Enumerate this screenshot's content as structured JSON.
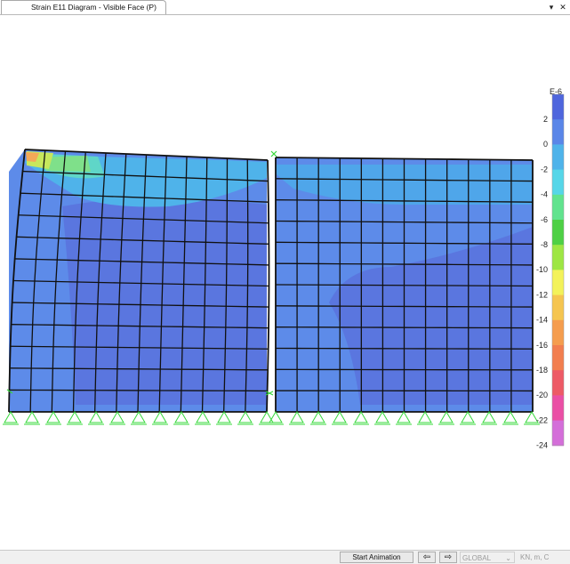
{
  "window": {
    "tab_title": "Strain E11 Diagram - Visible Face  (P)",
    "dropdown_icon": "chevron-down-icon",
    "close_icon": "close-icon"
  },
  "legend": {
    "title": "E-6",
    "ticks": [
      "2",
      "0",
      "-2",
      "-4",
      "-6",
      "-8",
      "-10",
      "-12",
      "-14",
      "-16",
      "-18",
      "-20",
      "-22",
      "-24"
    ],
    "colors": [
      "#4f66dd",
      "#5a86e8",
      "#4fb3ea",
      "#56d6e8",
      "#61e38e",
      "#4ed045",
      "#9ee644",
      "#f3f25a",
      "#f5c550",
      "#f59d4e",
      "#f27e4f",
      "#ed5a66",
      "#ea4fa5",
      "#d46ed9"
    ]
  },
  "statusbar": {
    "start_animation": "Start Animation",
    "prev_icon": "arrow-left-icon",
    "next_icon": "arrow-right-icon",
    "coord_system": "GLOBAL",
    "units": "KN, m, C"
  }
}
